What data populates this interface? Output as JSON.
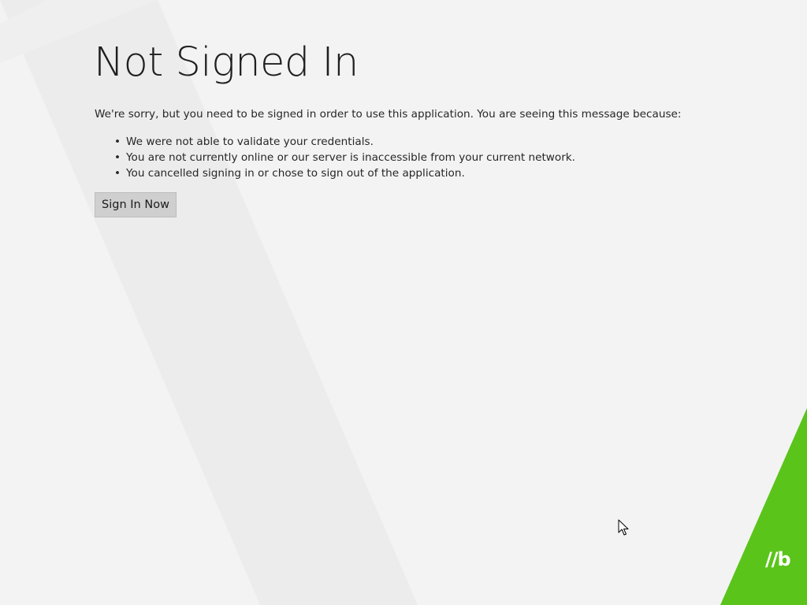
{
  "page": {
    "title": "Not Signed In",
    "message": "We're sorry, but you need to be signed in order to use this application. You are seeing this message because:",
    "reasons": [
      "We were not able to validate your credentials.",
      "You are not currently online or our server is inaccessible from your current network.",
      "You cancelled signing in or chose to sign out of the application."
    ],
    "bullet": "•",
    "signin_label": "Sign In Now"
  },
  "brand": {
    "logo_text": "//b",
    "accent_color": "#5ac41a",
    "background_color": "#f3f3f3"
  },
  "icons": {
    "cursor": "arrow-cursor-icon",
    "bullet": "bullet-icon"
  }
}
